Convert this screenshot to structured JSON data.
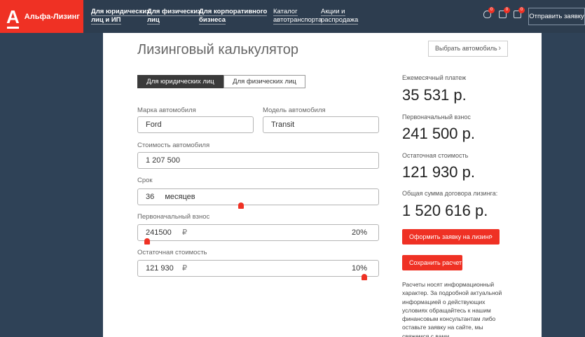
{
  "header": {
    "logo_glyph": "А",
    "brand_name": "Альфа-Лизинг",
    "nav": [
      {
        "line1": "Для юридических",
        "line2": "лиц и ИП"
      },
      {
        "line1": "Для физических",
        "line2": "лиц"
      },
      {
        "line1": "Для корпоративного",
        "line2": "бизнеса"
      },
      {
        "line1": "Каталог",
        "line2": "автотранспорта"
      },
      {
        "line1": "Акции и",
        "line2": "распродажа"
      }
    ],
    "icons": [
      {
        "name": "favorites-heart-icon",
        "badge": "0"
      },
      {
        "name": "compare-icon",
        "badge": "0"
      },
      {
        "name": "list-icon",
        "badge": "0"
      }
    ],
    "send_request": "Отправить заявку"
  },
  "calculator": {
    "title": "Лизинговый калькулятор",
    "choose_car": "Выбрать автомобиль",
    "chevron": "›",
    "tabs": [
      "Для юридических лиц",
      "Для физических лиц"
    ],
    "active_tab": "Для юридических лиц",
    "brand_label": "Марка автомобиля",
    "brand_value": "Ford",
    "model_label": "Модель автомобиля",
    "model_value": "Transit",
    "cost_label": "Стоимость автомобиля",
    "cost_value": "1 207 500",
    "term_label": "Срок",
    "term_value": "36",
    "term_unit": "месяцев",
    "term_slider_position": 0.43,
    "down_label": "Первоначальный взнос",
    "down_value": "241500",
    "down_currency": "₽",
    "down_percent": "20%",
    "down_slider_position": 0.04,
    "residual_label": "Остаточная стоимость",
    "residual_value": "121 930",
    "residual_currency": "₽",
    "residual_percent": "10%",
    "residual_slider_position": 0.94
  },
  "results": {
    "monthly_label": "Ежемесячный платеж",
    "monthly_value": "35 531 р.",
    "down_label": "Первоначальный взнос",
    "down_value": "241 500 р.",
    "residual_label": "Остаточная стоимость",
    "residual_value": "121 930 р.",
    "total_label": "Общая сумма договора лизинга:",
    "total_value": "1 520 616 р.",
    "apply_button": "Оформить заявку на лизинг",
    "save_button": "Сохранить расчет",
    "disclaimer": "Расчеты носят информационный характер. За подробной актуальной информацией о действующих условиях обращайтесь к нашим финансовым консультантам либо оставьте заявку на сайте, мы свяжемся с вами."
  },
  "colors": {
    "accent": "#ef3124",
    "header_bg": "#2d3d4f",
    "page_bg": "#2f4257"
  }
}
